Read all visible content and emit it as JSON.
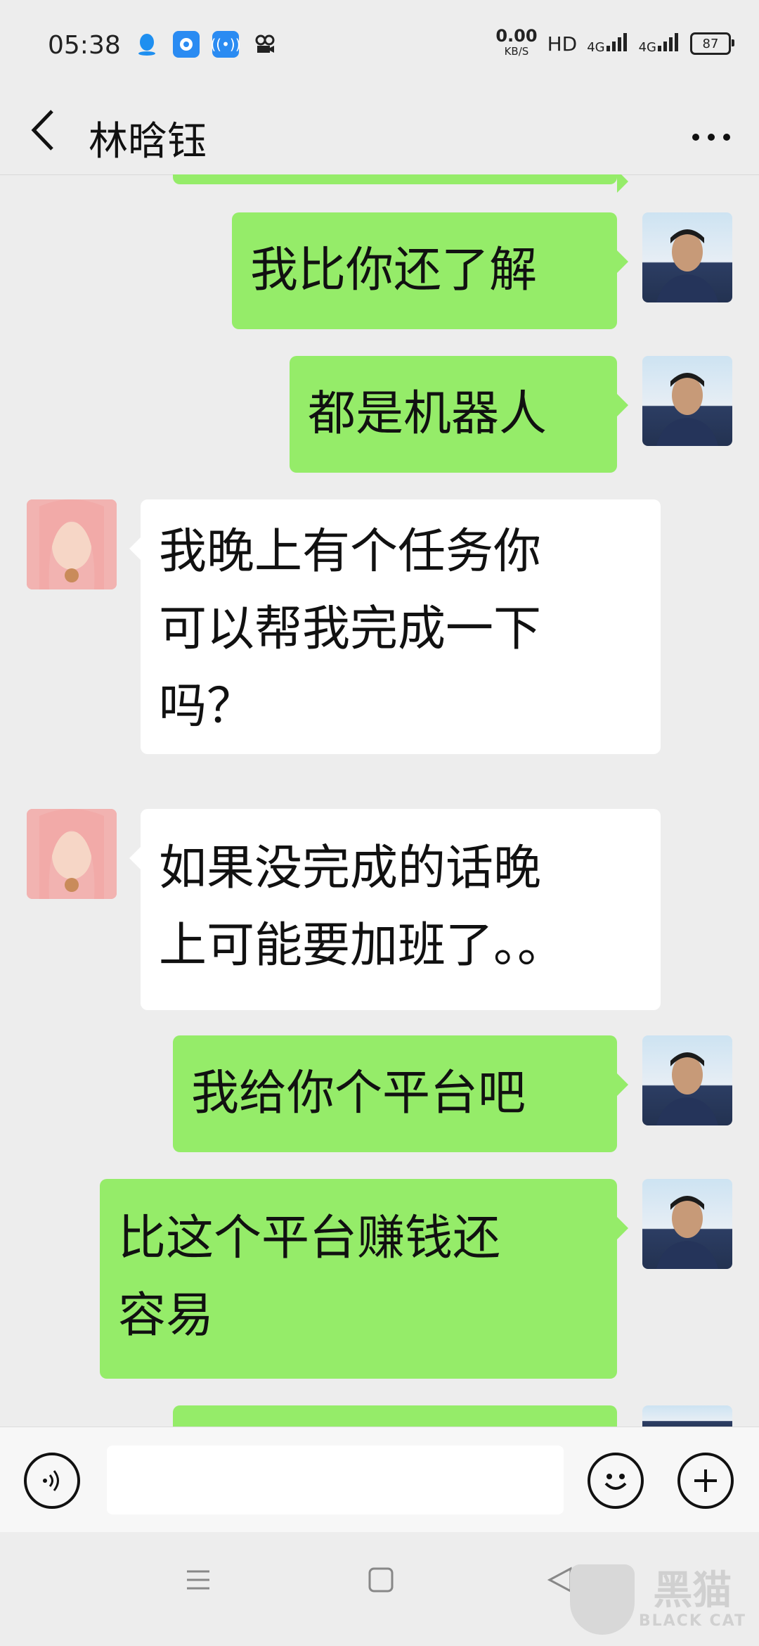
{
  "status_bar": {
    "time": "05:38",
    "net_speed_value": "0.00",
    "net_speed_unit": "KB/S",
    "hd_label": "HD",
    "signal_1": "4G",
    "signal_2": "4G",
    "battery": "87",
    "icons": [
      "qq-icon",
      "circle-app-icon",
      "wifi-hotspot-icon",
      "camera-icon"
    ]
  },
  "header": {
    "contact_name": "林晗钰",
    "back_icon": "chevron-left-icon",
    "more_icon": "more-dots-icon"
  },
  "messages": [
    {
      "id": 1,
      "side": "sent",
      "text": "我比你还了解"
    },
    {
      "id": 2,
      "side": "sent",
      "text": "都是机器人"
    },
    {
      "id": 3,
      "side": "received",
      "lines": [
        "我晚上有个任务你",
        "可以帮我完成一下",
        "吗？"
      ]
    },
    {
      "id": 4,
      "side": "received",
      "lines": [
        "如果没完成的话晚",
        "上可能要加班了。。"
      ]
    },
    {
      "id": 5,
      "side": "sent",
      "text": "我给你个平台吧"
    },
    {
      "id": 6,
      "side": "sent",
      "lines": [
        "比这个平台赚钱还",
        "容易"
      ]
    }
  ],
  "input_bar": {
    "voice_icon": "voice-icon",
    "emoji_icon": "emoji-icon",
    "plus_icon": "plus-icon"
  },
  "nav_bar": {
    "menu_icon": "menu-icon",
    "home_icon": "home-square-icon",
    "back_icon": "back-triangle-icon"
  },
  "watermark": {
    "text_cn": "黑猫",
    "text_en": "BLACK CAT"
  },
  "colors": {
    "sent_bubble": "#95ec69",
    "received_bubble": "#ffffff",
    "background": "#ededed"
  }
}
